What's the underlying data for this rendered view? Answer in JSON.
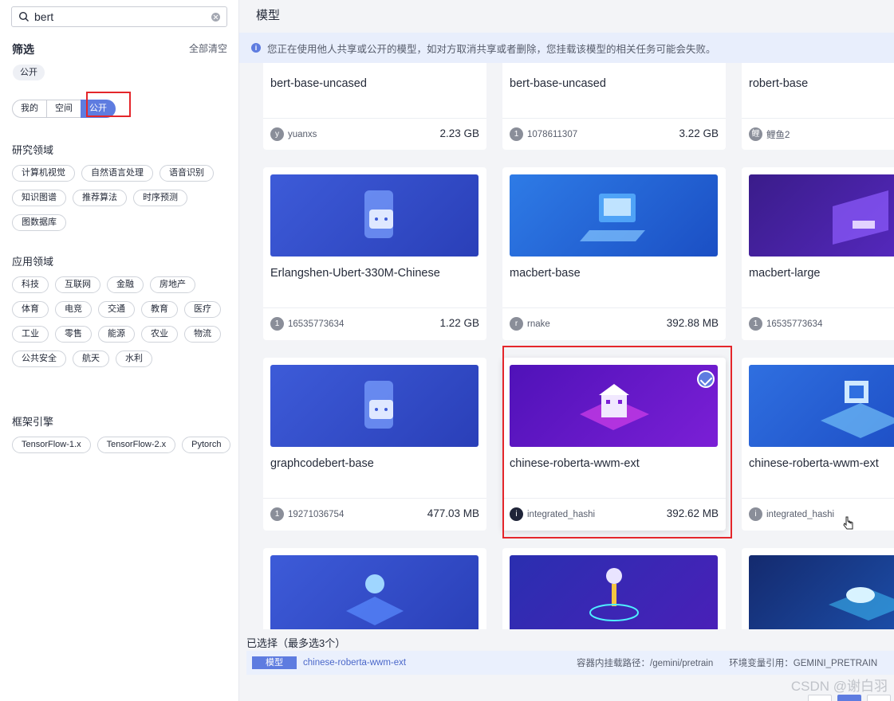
{
  "search": {
    "value": "bert"
  },
  "filter": {
    "title": "筛选",
    "clear_all": "全部清空",
    "selected_tag": "公开"
  },
  "visibility": [
    "我的",
    "空间",
    "公开"
  ],
  "sections": [
    {
      "title": "研究领域",
      "chips": [
        "计算机视觉",
        "自然语言处理",
        "语音识别",
        "知识图谱",
        "推荐算法",
        "时序预测",
        "图数据库"
      ]
    },
    {
      "title": "应用领域",
      "chips": [
        "科技",
        "互联网",
        "金融",
        "房地产",
        "体育",
        "电竞",
        "交通",
        "教育",
        "医疗",
        "工业",
        "零售",
        "能源",
        "农业",
        "物流",
        "公共安全",
        "航天",
        "水利"
      ]
    },
    {
      "title": "框架引擎",
      "chips": [
        "TensorFlow-1.x",
        "TensorFlow-2.x",
        "Pytorch"
      ]
    }
  ],
  "main": {
    "title": "模型",
    "notice": "您正在使用他人共享或公开的模型，如对方取消共享或者删除，您挂载该模型的相关任务可能会失败。"
  },
  "cards": [
    {
      "name": "bert-base-uncased",
      "owner": "yuanxs",
      "avatar": "y",
      "size": "2.23 GB"
    },
    {
      "name": "bert-base-uncased",
      "owner": "1078611307",
      "avatar": "1",
      "size": "3.22 GB"
    },
    {
      "name": "robert-base",
      "owner": "鲤鱼2",
      "avatar": "鲤",
      "size": ""
    },
    {
      "name": "Erlangshen-Ubert-330M-Chinese",
      "owner": "16535773634",
      "avatar": "1",
      "size": "1.22 GB"
    },
    {
      "name": "macbert-base",
      "owner": "rnake",
      "avatar": "r",
      "size": "392.88 MB"
    },
    {
      "name": "macbert-large",
      "owner": "16535773634",
      "avatar": "1",
      "size": ""
    },
    {
      "name": "graphcodebert-base",
      "owner": "19271036754",
      "avatar": "1",
      "size": "477.03 MB"
    },
    {
      "name": "chinese-roberta-wwm-ext",
      "owner": "integrated_hashi",
      "avatar": "i",
      "size": "392.62 MB",
      "selected": true
    },
    {
      "name": "chinese-roberta-wwm-ext",
      "owner": "integrated_hashi",
      "avatar": "i",
      "size": ""
    }
  ],
  "selection": {
    "title": "已选择（最多选3个）",
    "type": "模型",
    "model": "chinese-roberta-wwm-ext",
    "mount_path": "容器内挂载路径：/gemini/pretrain",
    "env_var": "环境变量引用：GEMINI_PRETRAIN"
  },
  "watermark": "CSDN @谢白羽",
  "colors": {
    "accent": "#5e7ce0",
    "highlight_box": "#e4262b"
  }
}
